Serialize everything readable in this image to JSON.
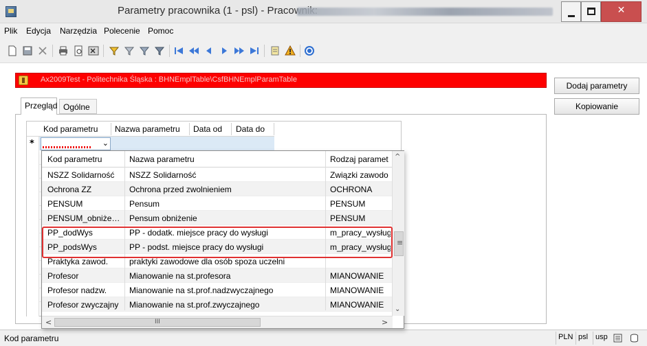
{
  "window": {
    "title": "Parametry pracownika (1 - psl) - Pracownik:"
  },
  "menu": {
    "items": [
      "Plik",
      "Edycja",
      "Narzędzia",
      "Polecenie",
      "Pomoc"
    ]
  },
  "toolbar": {
    "icons": [
      "new-icon",
      "save-icon",
      "delete-icon",
      "print-icon",
      "print-preview-icon",
      "excel-icon",
      "filter-by-selection-icon",
      "filter-by-field-icon",
      "advanced-filter-icon",
      "clear-filter-icon",
      "first-record-icon",
      "previous-page-icon",
      "previous-record-icon",
      "next-record-icon",
      "next-page-icon",
      "last-record-icon",
      "attachment-icon",
      "alert-icon",
      "help-icon"
    ]
  },
  "banner": {
    "text": "Ax2009Test - Politechnika Śląska : BHNEmplTable\\CsfBHNEmplParamTable"
  },
  "tabs": {
    "overview": "Przegląd",
    "general": "Ogólne"
  },
  "buttons": {
    "add_params": "Dodaj parametry",
    "copy": "Kopiowanie"
  },
  "grid": {
    "columns": [
      "Kod parametru",
      "Nazwa parametru",
      "Data od",
      "Data do"
    ],
    "new_row_marker": "*",
    "combo_arrow": "⌄"
  },
  "lookup": {
    "columns": [
      "Kod parametru",
      "Nazwa parametru",
      "Rodzaj paramet"
    ],
    "rows": [
      {
        "code": "NSZZ Solidarność",
        "name": "NSZZ Solidarność",
        "type": "Związki zawodo"
      },
      {
        "code": "Ochrona ZZ",
        "name": "Ochrona przed zwolnieniem",
        "type": "OCHRONA"
      },
      {
        "code": "PENSUM",
        "name": "Pensum",
        "type": "PENSUM"
      },
      {
        "code": "PENSUM_obniże…",
        "name": "Pensum obniżenie",
        "type": "PENSUM"
      },
      {
        "code": "PP_dodWys",
        "name": "PP - dodatk. miejsce pracy do wysługi",
        "type": "m_pracy_wysługi"
      },
      {
        "code": "PP_podsWys",
        "name": "PP - podst. miejsce pracy do wysługi",
        "type": "m_pracy_wysługi"
      },
      {
        "code": "Praktyka zawod.",
        "name": "praktyki zawodowe dla osób spoza uczelni",
        "type": ""
      },
      {
        "code": "Profesor",
        "name": "Mianowanie na st.profesora",
        "type": "MIANOWANIE"
      },
      {
        "code": "Profesor nadzw.",
        "name": "Mianowanie na st.prof.nadzwyczajnego",
        "type": "MIANOWANIE"
      },
      {
        "code": "Profesor zwyczajny",
        "name": "Mianowanie na st.prof.zwyczajnego",
        "type": "MIANOWANIE"
      }
    ],
    "scroll_up": "^",
    "scroll_down": "⌄",
    "scroll_left": "<",
    "scroll_right": ">",
    "grip": "III",
    "vgrip": "≡"
  },
  "status": {
    "text": "Kod parametru",
    "currency": "PLN",
    "company": "psl",
    "layer": "usp"
  },
  "colors": {
    "banner": "#fe0000",
    "highlight": "#e03030",
    "selected_row": "#dbe9f6"
  }
}
